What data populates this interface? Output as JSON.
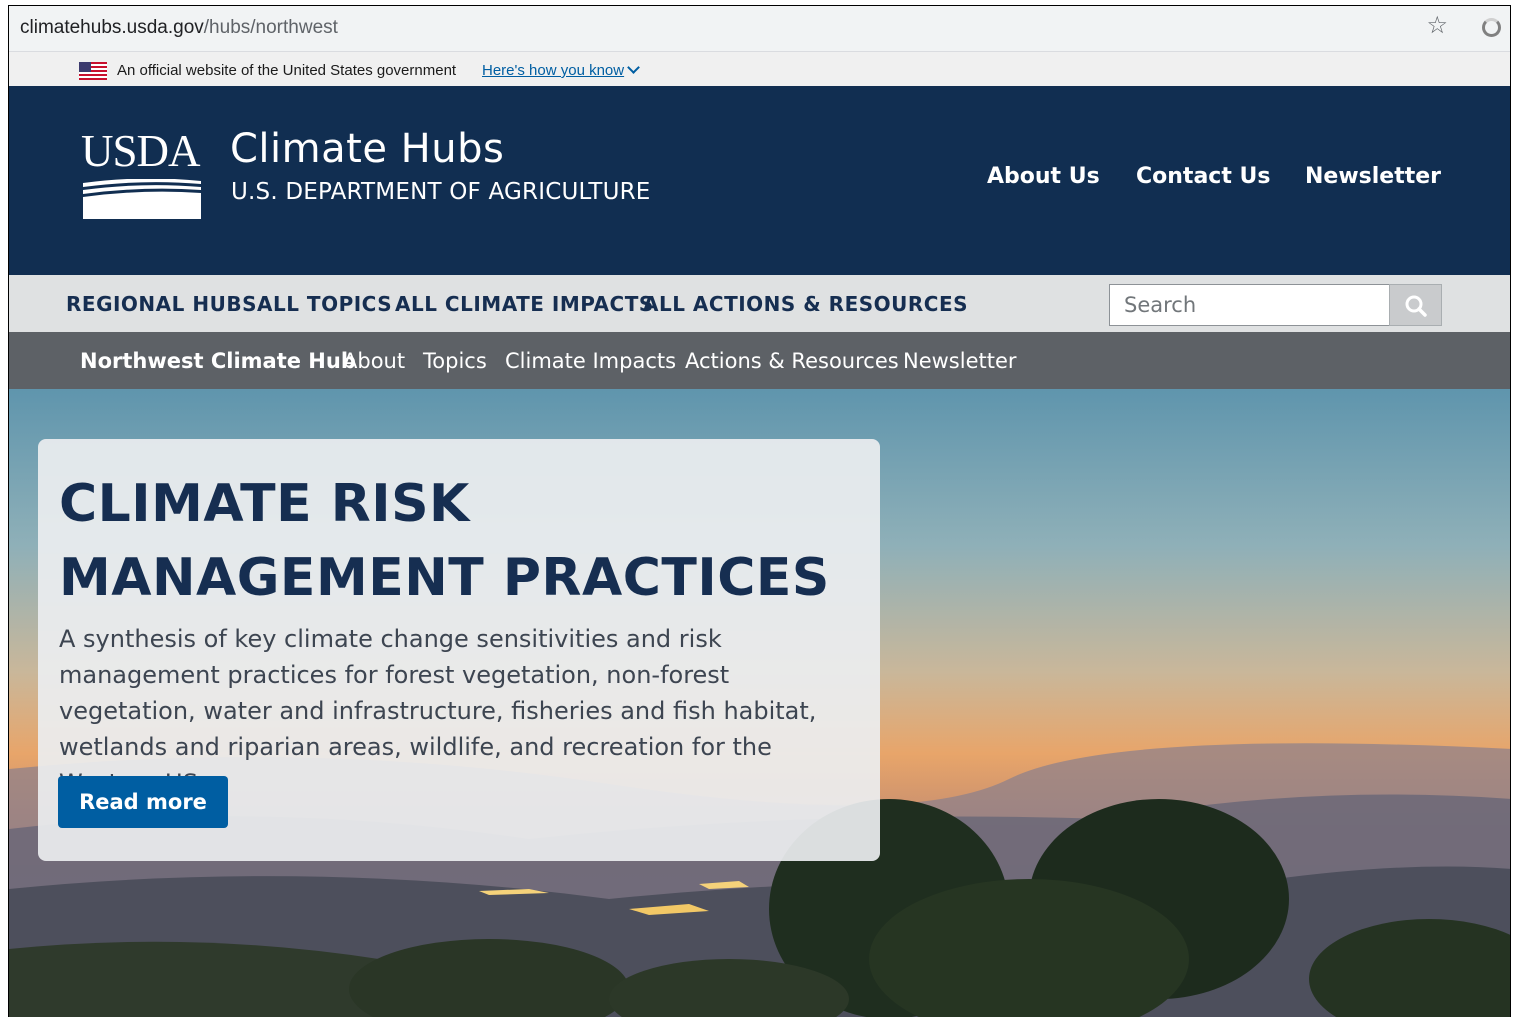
{
  "browser": {
    "url_domain": "climatehubs.usda.gov",
    "url_path": "/hubs/northwest"
  },
  "gov_banner": {
    "text": "An official website of the United States government",
    "link": "Here's how you know"
  },
  "header": {
    "logo_text": "USDA",
    "title": "Climate Hubs",
    "subtitle": "U.S. DEPARTMENT OF AGRICULTURE",
    "links": [
      "About Us",
      "Contact Us",
      "Newsletter"
    ]
  },
  "main_nav": {
    "items": [
      "REGIONAL HUBS",
      "ALL TOPICS",
      "ALL CLIMATE IMPACTS",
      "ALL ACTIONS & RESOURCES"
    ],
    "search_placeholder": "Search"
  },
  "sub_nav": {
    "items": [
      "Northwest Climate Hub",
      "About",
      "Topics",
      "Climate Impacts",
      "Actions & Resources",
      "Newsletter"
    ]
  },
  "hero": {
    "title": "CLIMATE RISK MANAGEMENT PRACTICES",
    "text": "A synthesis of key climate change sensitivities and risk management practices for forest vegetation, non-forest vegetation, water and infrastructure, fisheries and fish habitat, wetlands and riparian areas, wildlife, and recreation for the Western US.",
    "button": "Read more"
  },
  "colors": {
    "header_bg": "#112e51",
    "main_nav_bg": "#dfe1e2",
    "sub_nav_bg": "#5d6166",
    "button_bg": "#005ea2",
    "title_color": "#162e51"
  }
}
